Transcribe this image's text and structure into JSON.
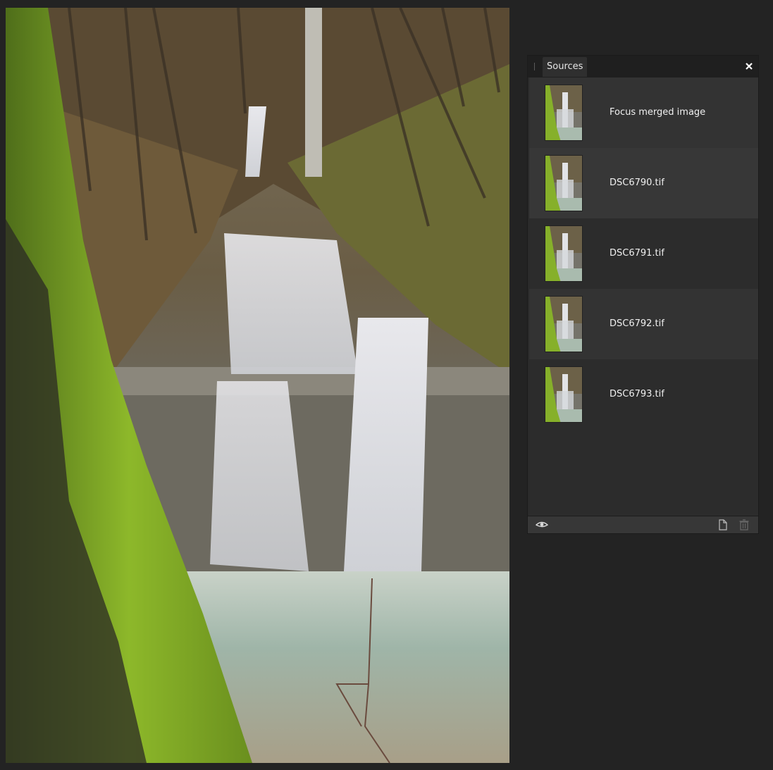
{
  "canvas": {
    "image_name": "waterfall-photo"
  },
  "panel": {
    "tab_label": "Sources",
    "close_icon": "close-icon",
    "sources": [
      {
        "label": "Focus merged image"
      },
      {
        "label": "DSC6790.tif"
      },
      {
        "label": "DSC6791.tif"
      },
      {
        "label": "DSC6792.tif"
      },
      {
        "label": "DSC6793.tif"
      }
    ],
    "footer": {
      "left_icon": "eye-icon",
      "right_icons": [
        "new-document-icon",
        "trash-icon"
      ]
    }
  },
  "colors": {
    "app_background": "#232323",
    "panel_background": "#2a2a2a",
    "row_highlight": "#333333",
    "text": "#f0f0f0"
  }
}
